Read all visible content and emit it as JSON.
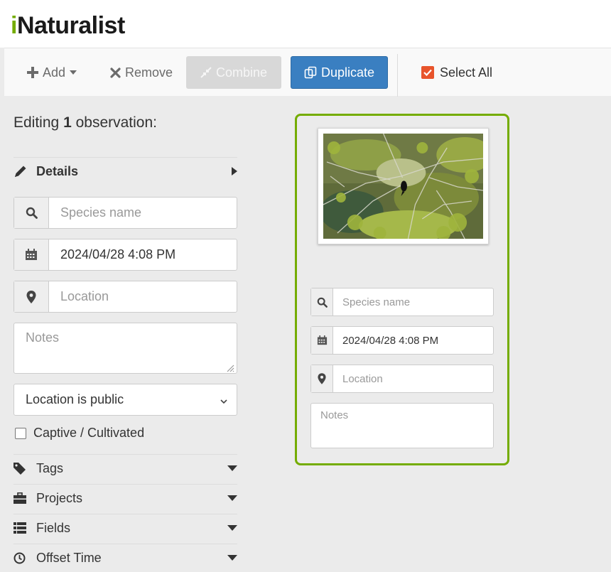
{
  "app": {
    "logo_text": "Naturalist",
    "logo_initial": "i"
  },
  "toolbar": {
    "add_label": "Add",
    "remove_label": "Remove",
    "combine_label": "Combine",
    "duplicate_label": "Duplicate",
    "select_all_label": "Select All",
    "select_all_checked": true
  },
  "editor": {
    "title_prefix": "Editing",
    "count": "1",
    "title_suffix": "observation:",
    "details_label": "Details",
    "species_placeholder": "Species name",
    "date_value": "2024/04/28 4:08 PM",
    "location_placeholder": "Location",
    "notes_placeholder": "Notes",
    "geoprivacy_value": "Location is public",
    "captive_label": "Captive / Cultivated",
    "captive_checked": false,
    "sections": [
      {
        "label": "Tags",
        "icon": "tag-icon"
      },
      {
        "label": "Projects",
        "icon": "briefcase-icon"
      },
      {
        "label": "Fields",
        "icon": "list-icon"
      },
      {
        "label": "Offset Time",
        "icon": "clock-icon"
      }
    ]
  },
  "card": {
    "photo_alt": "bird in tree",
    "species_placeholder": "Species name",
    "date_value": "2024/04/28 4:08 PM",
    "location_placeholder": "Location",
    "notes_placeholder": "Notes"
  },
  "colors": {
    "brand_green": "#74ac00",
    "primary_blue": "#3a7fc1",
    "checkbox_orange": "#e8542b"
  }
}
